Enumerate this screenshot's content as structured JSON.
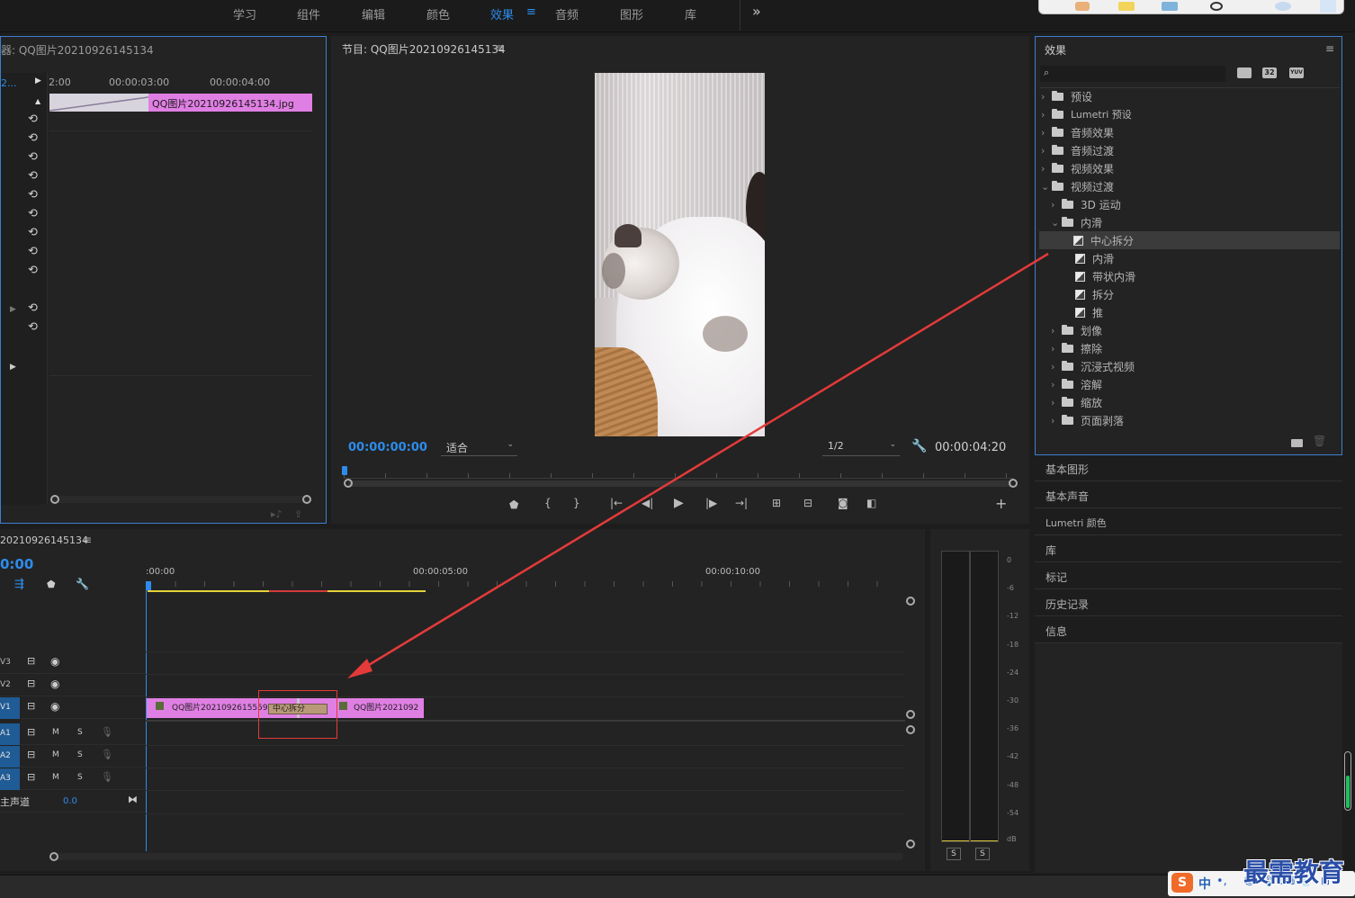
{
  "workspace_tabs": [
    {
      "label": "学习",
      "active": false
    },
    {
      "label": "组件",
      "active": false
    },
    {
      "label": "编辑",
      "active": false
    },
    {
      "label": "颜色",
      "active": false
    },
    {
      "label": "效果",
      "active": true
    },
    {
      "label": "音频",
      "active": false
    },
    {
      "label": "图形",
      "active": false
    },
    {
      "label": "库",
      "active": false
    }
  ],
  "workspace_overflow": "»",
  "effect_controls": {
    "title": "器: QQ图片20210926145134",
    "clip_prefix": "2...",
    "ruler": [
      "2:00",
      "00:00:03:00",
      "00:00:04:00"
    ],
    "clip_label": "QQ图片20210926145134.jpg"
  },
  "program_monitor": {
    "title": "节目: QQ图片20210926145134",
    "timecode": "00:00:00:00",
    "fit": "适合",
    "resolution": "1/2",
    "duration": "00:00:04:20"
  },
  "effects_panel": {
    "title": "效果",
    "badges": [
      "32",
      "YUV"
    ],
    "items": [
      {
        "label": "预设",
        "level": 0,
        "type": "folder-star",
        "open": false
      },
      {
        "label": "Lumetri 预设",
        "level": 0,
        "type": "folder-star",
        "open": false
      },
      {
        "label": "音频效果",
        "level": 0,
        "type": "folder",
        "open": false
      },
      {
        "label": "音频过渡",
        "level": 0,
        "type": "folder",
        "open": false
      },
      {
        "label": "视频效果",
        "level": 0,
        "type": "folder",
        "open": false
      },
      {
        "label": "视频过渡",
        "level": 0,
        "type": "folder",
        "open": true
      },
      {
        "label": "3D 运动",
        "level": 1,
        "type": "folder",
        "open": false
      },
      {
        "label": "内滑",
        "level": 1,
        "type": "folder",
        "open": true
      },
      {
        "label": "中心拆分",
        "level": 2,
        "type": "effect",
        "selected": true
      },
      {
        "label": "内滑",
        "level": 2,
        "type": "effect"
      },
      {
        "label": "带状内滑",
        "level": 2,
        "type": "effect"
      },
      {
        "label": "拆分",
        "level": 2,
        "type": "effect"
      },
      {
        "label": "推",
        "level": 2,
        "type": "effect"
      },
      {
        "label": "划像",
        "level": 1,
        "type": "folder",
        "open": false
      },
      {
        "label": "擦除",
        "level": 1,
        "type": "folder",
        "open": false
      },
      {
        "label": "沉浸式视频",
        "level": 1,
        "type": "folder",
        "open": false
      },
      {
        "label": "溶解",
        "level": 1,
        "type": "folder",
        "open": false
      },
      {
        "label": "缩放",
        "level": 1,
        "type": "folder",
        "open": false
      },
      {
        "label": "页面剥落",
        "level": 1,
        "type": "folder",
        "open": false
      }
    ]
  },
  "side_panels": [
    "基本图形",
    "基本声音",
    "Lumetri 颜色",
    "库",
    "标记",
    "历史记录",
    "信息"
  ],
  "timeline": {
    "title": "20210926145134",
    "timecode": "0:00",
    "ruler": [
      ":00:00",
      "00:00:05:00",
      "00:00:10:00"
    ],
    "tracks": [
      {
        "label": "V3",
        "kind": "video"
      },
      {
        "label": "V2",
        "kind": "video"
      },
      {
        "label": "V1",
        "kind": "video"
      },
      {
        "label": "A1",
        "kind": "audio",
        "m": "M",
        "s": "S"
      },
      {
        "label": "A2",
        "kind": "audio",
        "m": "M",
        "s": "S"
      },
      {
        "label": "A3",
        "kind": "audio",
        "m": "M",
        "s": "S"
      }
    ],
    "master_label": "主声道",
    "master_value": "0.0",
    "clip1": "QQ图片20210926155592",
    "transition": "中心拆分",
    "clip2": "QQ图片2021092"
  },
  "audio_meter": {
    "ticks": [
      "0",
      "-6",
      "-12",
      "-18",
      "-24",
      "-30",
      "-36",
      "-42",
      "-48",
      "-54",
      "dB"
    ],
    "solo": [
      "S",
      "S"
    ]
  },
  "watermark": {
    "text": "最需教育",
    "ime": "中"
  },
  "colors": {
    "accent": "#2d8ceb",
    "clip_pink": "#e07fe3",
    "annotation_red": "#e43a3a",
    "panel": "#232323",
    "bg": "#1d1d1d"
  }
}
